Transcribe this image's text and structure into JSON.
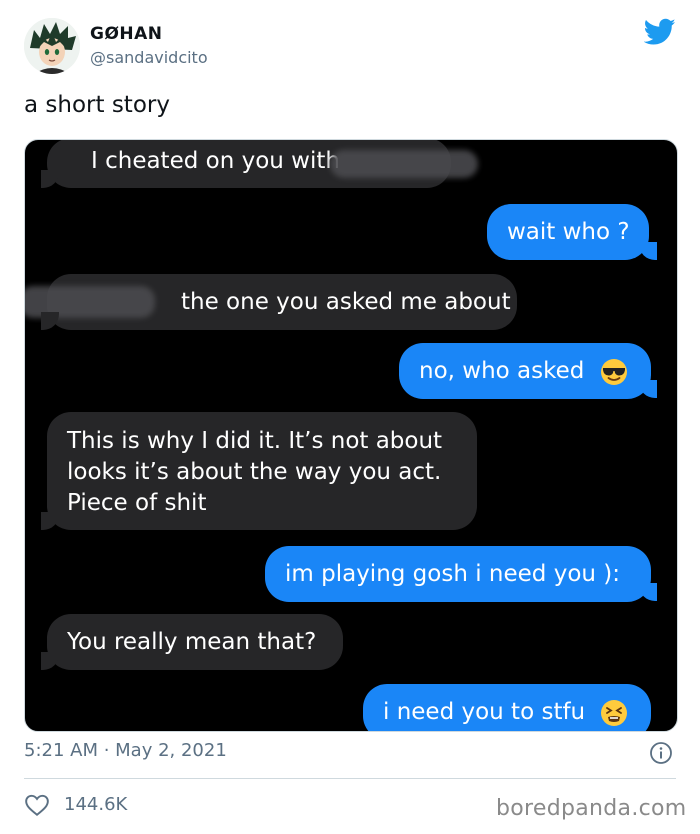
{
  "tweet": {
    "author_name": "GØHAN",
    "author_handle": "@sandavidcito",
    "text": "a short story",
    "timestamp": "5:21 AM · May 2, 2021",
    "likes": "144.6K"
  },
  "messages": [
    {
      "side": "in",
      "text": "I cheated on you with"
    },
    {
      "side": "out",
      "text": "wait who ?"
    },
    {
      "side": "in",
      "text": "the one you asked me about"
    },
    {
      "side": "out",
      "text": "no, who asked",
      "emoji": "sunglasses-emoji"
    },
    {
      "side": "in",
      "lines": [
        "This is why I did it. It’s not about",
        "looks it’s about the way you act.",
        "Piece of shit"
      ]
    },
    {
      "side": "out",
      "text": "im playing gosh i need you ):"
    },
    {
      "side": "in",
      "text": "You really mean that?"
    },
    {
      "side": "out",
      "text": "i need you to stfu",
      "emoji": "tired-face-emoji"
    }
  ],
  "watermark": "boredpanda.com",
  "colors": {
    "twitter_blue": "#1d9bf0",
    "imessage_blue": "#1a86f7",
    "received_bubble": "#262628",
    "secondary_text": "#5b7083"
  }
}
